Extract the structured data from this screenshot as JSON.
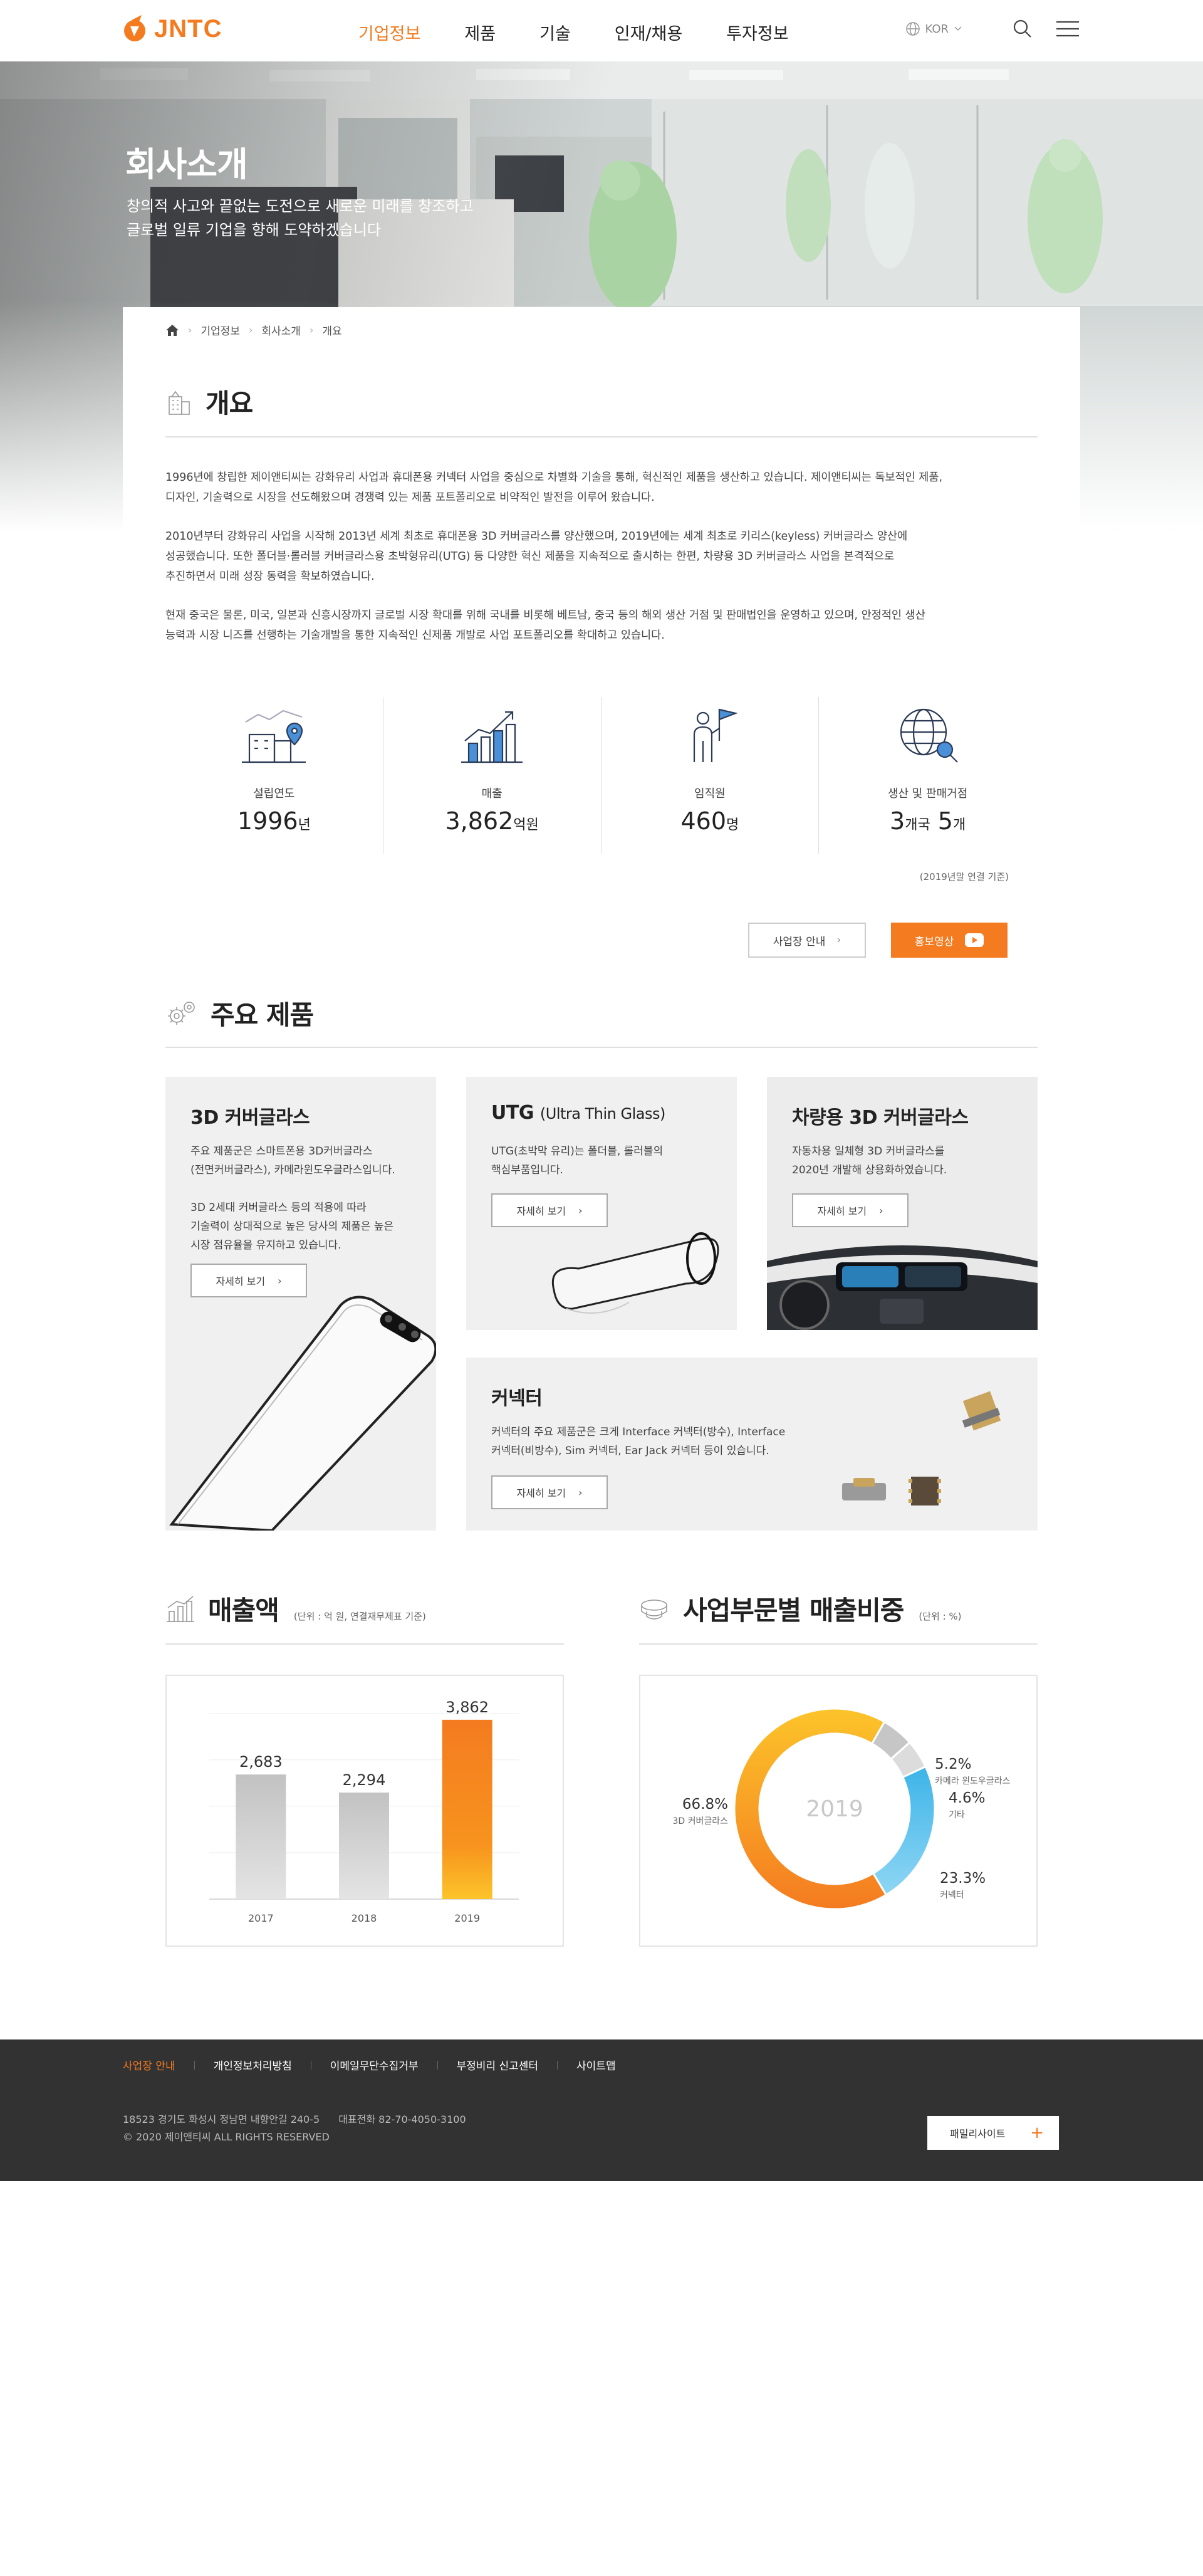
{
  "brand": {
    "logo_text": "JNTC",
    "accent": "#f47b20"
  },
  "nav": {
    "items": [
      "기업정보",
      "제품",
      "기술",
      "인재/채용",
      "투자정보"
    ],
    "active_index": 0
  },
  "util": {
    "lang": "KOR"
  },
  "hero": {
    "title": "회사소개",
    "subtitle_line1": "창의적 사고와 끝없는 도전으로 새로운 미래를 창조하고",
    "subtitle_line2": "글로벌 일류 기업을 향해 도약하겠습니다"
  },
  "breadcrumb": {
    "items": [
      "기업정보",
      "회사소개",
      "개요"
    ]
  },
  "overview": {
    "title": "개요",
    "p1_l1": "1996년에 창립한 제이앤티씨는 강화유리 사업과 휴대폰용 커넥터 사업을 중심으로 차별화 기술을 통해, 혁신적인 제품을 생산하고 있습니다. 제이앤티씨는 독보적인 제품,",
    "p1_l2": "디자인, 기술력으로 시장을 선도해왔으며 경쟁력 있는 제품 포트폴리오로 비약적인 발전을 이루어 왔습니다.",
    "p2_l1": "2010년부터 강화유리 사업을 시작해 2013년 세계 최초로 휴대폰용 3D 커버글라스를 양산했으며, 2019년에는 세계 최초로 키리스(keyless) 커버글라스 양산에",
    "p2_l2": "성공했습니다. 또한 폴더블·롤러블 커버글라스용 초박형유리(UTG) 등 다양한 혁신 제품을 지속적으로 출시하는 한편, 차량용 3D 커버글라스 사업을 본격적으로",
    "p2_l3": "추진하면서 미래 성장 동력을 확보하였습니다.",
    "p3_l1": "현재 중국은 물론, 미국, 일본과 신흥시장까지 글로벌 시장 확대를 위해 국내를 비롯해 베트남, 중국 등의 해외 생산 거점 및 판매법인을 운영하고 있으며, 안정적인 생산",
    "p3_l2": "능력과 시장 니즈를 선행하는 기술개발을 통한 지속적인 신제품 개발로 사업 포트폴리오를 확대하고 있습니다."
  },
  "stats": [
    {
      "label": "설립연도",
      "value": "1996",
      "unit": "년",
      "icon": "building-location-icon"
    },
    {
      "label": "매출",
      "value": "3,862",
      "unit": "억원",
      "icon": "growth-chart-icon"
    },
    {
      "label": "임직원",
      "value": "460",
      "unit": "명",
      "icon": "person-flag-icon"
    },
    {
      "label": "생산 및 판매거점",
      "value": "3",
      "unit": "개국",
      "value2": "5",
      "unit2": "개",
      "icon": "globe-search-icon"
    }
  ],
  "stats_note": "(2019년말 연결 기준)",
  "buttons": {
    "site_guide": "사업장 안내",
    "promo_video": "홍보영상"
  },
  "products": {
    "title": "주요 제품",
    "more_label": "자세히 보기",
    "cover3d": {
      "title": "3D 커버글라스",
      "l1": "주요 제품군은 스마트폰용 3D커버글라스",
      "l2": "(전면커버글라스), 카메라윈도우글라스입니다.",
      "l3": "3D 2세대 커버글라스 등의 적용에 따라",
      "l4": "기술력이 상대적으로 높은 당사의 제품은 높은",
      "l5": "시장 점유율을 유지하고 있습니다."
    },
    "utg": {
      "title": "UTG",
      "title_small": "(Ultra Thin Glass)",
      "l1": "UTG(초박막 유리)는 폴더블, 롤러블의",
      "l2": "핵심부품입니다."
    },
    "vehicle": {
      "title": "차량용 3D 커버글라스",
      "l1": "자동차용 일체형 3D 커버글라스를",
      "l2": "2020년 개발해 상용화하였습니다."
    },
    "connector": {
      "title": "커넥터",
      "l1": "커넥터의 주요 제품군은 크게 Interface 커넥터(방수), Interface",
      "l2": "커넥터(비방수), Sim 커넥터, Ear Jack 커넥터 등이 있습니다."
    }
  },
  "sales": {
    "title": "매출액",
    "unit_note": "(단위 : 억 원, 연결재무제표 기준)"
  },
  "ratio": {
    "title": "사업부문별 매출비중",
    "unit_note": "(단위 : %)",
    "center_label": "2019"
  },
  "chart_data": [
    {
      "type": "bar",
      "categories": [
        "2017",
        "2018",
        "2019"
      ],
      "values": [
        2683,
        2294,
        3862
      ],
      "value_labels": [
        "2,683",
        "2,294",
        "3,862"
      ],
      "title": "매출액",
      "colors": {
        "past": "#c4c4c4",
        "current": "#f47b20"
      }
    },
    {
      "type": "pie",
      "labels": [
        "3D 커버글라스",
        "카메라 윈도우글라스",
        "기타",
        "커넥터"
      ],
      "values": [
        66.8,
        5.2,
        4.6,
        23.3
      ],
      "value_labels": [
        "66.8%",
        "5.2%",
        "4.6%",
        "23.3%"
      ],
      "title": "사업부문별 매출비중",
      "colors": [
        "#f5a623",
        "#c8c8c8",
        "#dcdcdc",
        "#5bc0eb"
      ]
    }
  ],
  "footer": {
    "links": [
      "사업장 안내",
      "개인정보처리방침",
      "이메일무단수집거부",
      "부정비리 신고센터",
      "사이트맵"
    ],
    "address": "18523 경기도 화성시 정남면 내향안길 240-5",
    "tel": "대표전화 82-70-4050-3100",
    "copyright": "© 2020 제이앤티씨 ALL RIGHTS RESERVED",
    "family_site": "패밀리사이트"
  }
}
